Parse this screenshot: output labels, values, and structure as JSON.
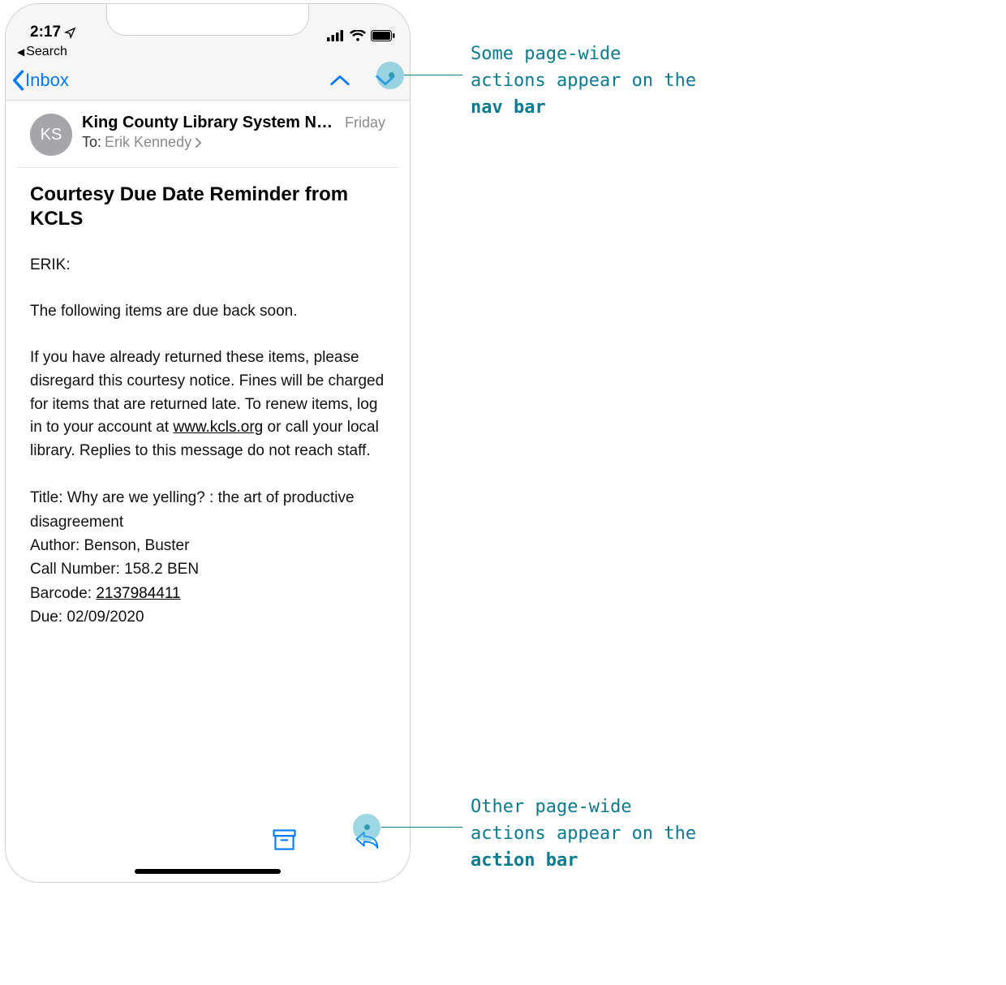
{
  "status": {
    "time": "2:17",
    "breadcrumb": "Search"
  },
  "nav": {
    "back_label": "Inbox"
  },
  "email": {
    "avatar_initials": "KS",
    "sender": "King County Library System Noti…",
    "date": "Friday",
    "to_label": "To:",
    "to_name": "Erik Kennedy",
    "subject": "Courtesy Due Date Reminder from KCLS",
    "greeting": "ERIK:",
    "p1": "The following items are due back soon.",
    "p2a": "If you have already returned these items, please disregard this courtesy notice. Fines will be charged for items that are returned late. To renew items, log in to your account at ",
    "link": "www.kcls.org",
    "p2b": " or call your local library. Replies to this message do not reach staff.",
    "item_title": "Title: Why are we yelling? : the art of productive disagreement",
    "item_author": "Author: Benson, Buster",
    "item_call": "Call Number: 158.2 BEN",
    "barcode_label": "Barcode: ",
    "barcode_value": "2137984411",
    "item_due": "Due: 02/09/2020"
  },
  "annotations": {
    "top_line1": "Some page-wide",
    "top_line2": "actions appear on the",
    "top_bold": "nav bar",
    "bottom_line1": "Other page-wide",
    "bottom_line2": "actions appear on the",
    "bottom_bold": "action bar"
  }
}
